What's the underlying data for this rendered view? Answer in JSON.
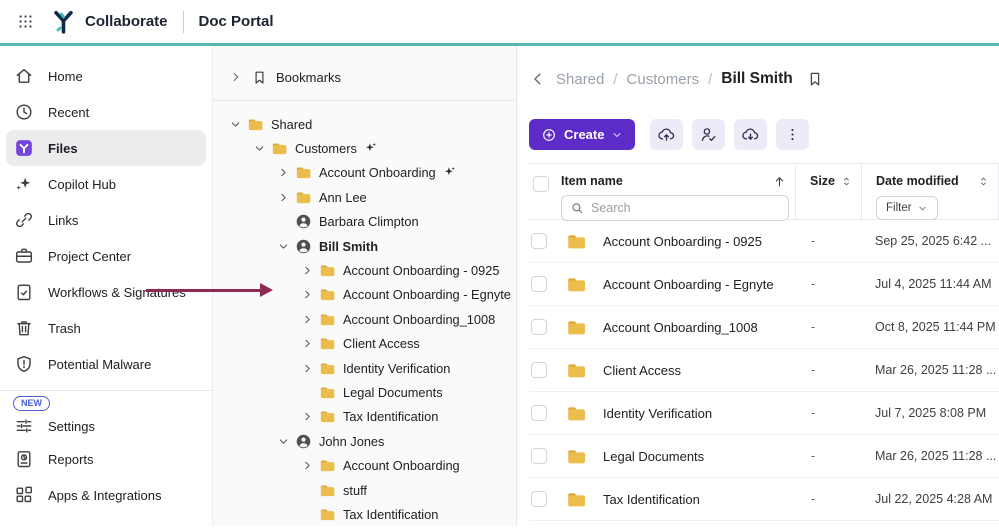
{
  "header": {
    "app_name": "Collaborate",
    "portal_name": "Doc Portal"
  },
  "sidebar": {
    "items": [
      {
        "label": "Home",
        "icon": "home",
        "active": false
      },
      {
        "label": "Recent",
        "icon": "recent",
        "active": false
      },
      {
        "label": "Files",
        "icon": "files-app",
        "active": true
      },
      {
        "label": "Copilot Hub",
        "icon": "copilot",
        "active": false
      },
      {
        "label": "Links",
        "icon": "link",
        "active": false
      },
      {
        "label": "Project Center",
        "icon": "briefcase",
        "active": false
      },
      {
        "label": "Workflows & Signatures",
        "icon": "clipboard-check",
        "active": false
      },
      {
        "label": "Trash",
        "icon": "trash",
        "active": false
      },
      {
        "label": "Potential Malware",
        "icon": "shield-alert",
        "active": false
      }
    ],
    "new_badge": "NEW",
    "bottom_items": [
      {
        "label": "Settings",
        "icon": "sliders"
      },
      {
        "label": "Reports",
        "icon": "report"
      },
      {
        "label": "Apps & Integrations",
        "icon": "apps"
      }
    ]
  },
  "tree": {
    "bookmarks_label": "Bookmarks",
    "items": [
      {
        "label": "Shared",
        "icon": "folder",
        "chevron": "down",
        "level": 0
      },
      {
        "label": "Customers",
        "icon": "folder",
        "chevron": "down",
        "level": 1,
        "sparkle": true
      },
      {
        "label": "Account Onboarding",
        "icon": "folder",
        "chevron": "right",
        "level": 2,
        "sparkle": true
      },
      {
        "label": "Ann Lee",
        "icon": "folder",
        "chevron": "right",
        "level": 2
      },
      {
        "label": "Barbara Climpton",
        "icon": "user",
        "chevron": "none",
        "level": 2
      },
      {
        "label": "Bill Smith",
        "icon": "user",
        "chevron": "down",
        "level": 2,
        "bold": true
      },
      {
        "label": "Account Onboarding - 0925",
        "icon": "folder",
        "chevron": "right",
        "level": 3
      },
      {
        "label": "Account Onboarding - Egnyte",
        "icon": "folder",
        "chevron": "right",
        "level": 3
      },
      {
        "label": "Account Onboarding_1008",
        "icon": "folder",
        "chevron": "right",
        "level": 3
      },
      {
        "label": "Client Access",
        "icon": "folder",
        "chevron": "right",
        "level": 3
      },
      {
        "label": "Identity Verification",
        "icon": "folder",
        "chevron": "right",
        "level": 3
      },
      {
        "label": "Legal Documents",
        "icon": "folder",
        "chevron": "none",
        "level": 3
      },
      {
        "label": "Tax Identification",
        "icon": "folder",
        "chevron": "right",
        "level": 3
      },
      {
        "label": "John Jones",
        "icon": "user",
        "chevron": "down",
        "level": 2
      },
      {
        "label": "Account Onboarding",
        "icon": "folder",
        "chevron": "right",
        "level": 3
      },
      {
        "label": "stuff",
        "icon": "folder",
        "chevron": "none",
        "level": 3
      },
      {
        "label": "Tax Identification",
        "icon": "folder",
        "chevron": "none",
        "level": 3
      }
    ]
  },
  "content": {
    "breadcrumb": {
      "parts": [
        "Shared",
        "Customers"
      ],
      "separator": "/",
      "current": "Bill Smith"
    },
    "toolbar": {
      "create_label": "Create"
    },
    "table": {
      "columns": {
        "name": "Item name",
        "size": "Size",
        "date": "Date modified"
      },
      "search_placeholder": "Search",
      "filter_label": "Filter",
      "rows": [
        {
          "name": "Account Onboarding - 0925",
          "size": "-",
          "date": "Sep 25, 2025 6:42 ..."
        },
        {
          "name": "Account Onboarding - Egnyte",
          "size": "-",
          "date": "Jul 4, 2025 11:44 AM"
        },
        {
          "name": "Account Onboarding_1008",
          "size": "-",
          "date": "Oct 8, 2025 11:44 PM"
        },
        {
          "name": "Client Access",
          "size": "-",
          "date": "Mar 26, 2025 11:28 ..."
        },
        {
          "name": "Identity Verification",
          "size": "-",
          "date": "Jul 7, 2025 8:08 PM"
        },
        {
          "name": "Legal Documents",
          "size": "-",
          "date": "Mar 26, 2025 11:28 ..."
        },
        {
          "name": "Tax Identification",
          "size": "-",
          "date": "Jul 22, 2025 4:28 AM"
        }
      ]
    }
  },
  "colors": {
    "accent_teal": "#58b7af",
    "brand_navy": "#14294e",
    "primary_purple": "#5d2bc7",
    "toolbar_button_bg": "#edebf8",
    "folder_yellow": "#eabd4c",
    "annotation_arrow": "#8e2a52",
    "active_item_bg": "#ececef",
    "new_badge_blue": "#4a5fd0"
  }
}
